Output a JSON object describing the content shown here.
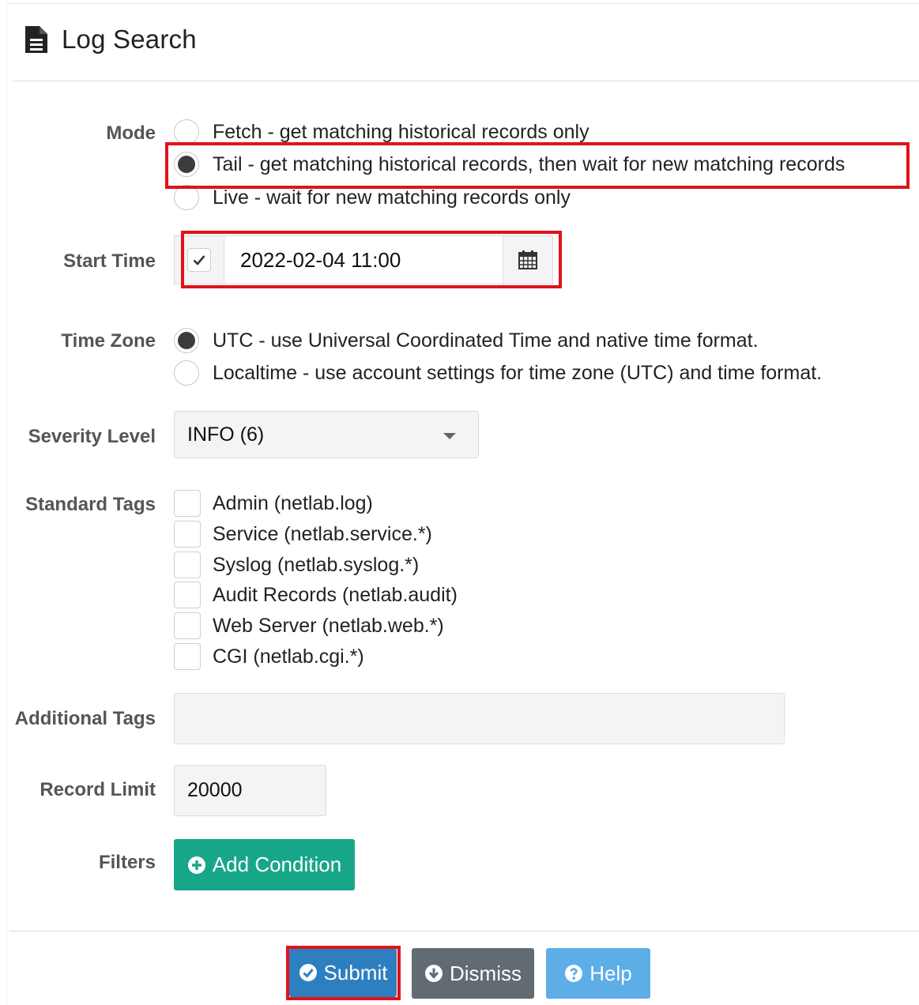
{
  "header": {
    "title": "Log Search",
    "icon": "document-icon"
  },
  "form": {
    "mode": {
      "label": "Mode",
      "options": [
        {
          "text": "Fetch - get matching historical records only",
          "checked": false
        },
        {
          "text": "Tail - get matching historical records, then wait for new matching records",
          "checked": true
        },
        {
          "text": "Live - wait for new matching records only",
          "checked": false
        }
      ]
    },
    "start_time": {
      "label": "Start Time",
      "enabled": true,
      "value": "2022-02-04 11:00",
      "icon": "calendar-icon"
    },
    "time_zone": {
      "label": "Time Zone",
      "options": [
        {
          "text": "UTC - use Universal Coordinated Time and native time format.",
          "checked": true
        },
        {
          "text": "Localtime - use account settings for time zone (UTC) and time format.",
          "checked": false
        }
      ]
    },
    "severity": {
      "label": "Severity Level",
      "value": "INFO (6)"
    },
    "standard_tags": {
      "label": "Standard Tags",
      "items": [
        {
          "text": "Admin (netlab.log)",
          "checked": false
        },
        {
          "text": "Service (netlab.service.*)",
          "checked": false
        },
        {
          "text": "Syslog (netlab.syslog.*)",
          "checked": false
        },
        {
          "text": "Audit Records (netlab.audit)",
          "checked": false
        },
        {
          "text": "Web Server (netlab.web.*)",
          "checked": false
        },
        {
          "text": "CGI (netlab.cgi.*)",
          "checked": false
        }
      ]
    },
    "additional_tags": {
      "label": "Additional Tags",
      "value": ""
    },
    "record_limit": {
      "label": "Record Limit",
      "value": "20000"
    },
    "filters": {
      "label": "Filters",
      "add_button": "Add Condition"
    }
  },
  "footer": {
    "submit": "Submit",
    "dismiss": "Dismiss",
    "help": "Help"
  },
  "colors": {
    "highlight": "#e0131a",
    "add_button": "#18a689",
    "submit": "#2e7fbf",
    "dismiss": "#636b72",
    "help": "#5dade6"
  }
}
